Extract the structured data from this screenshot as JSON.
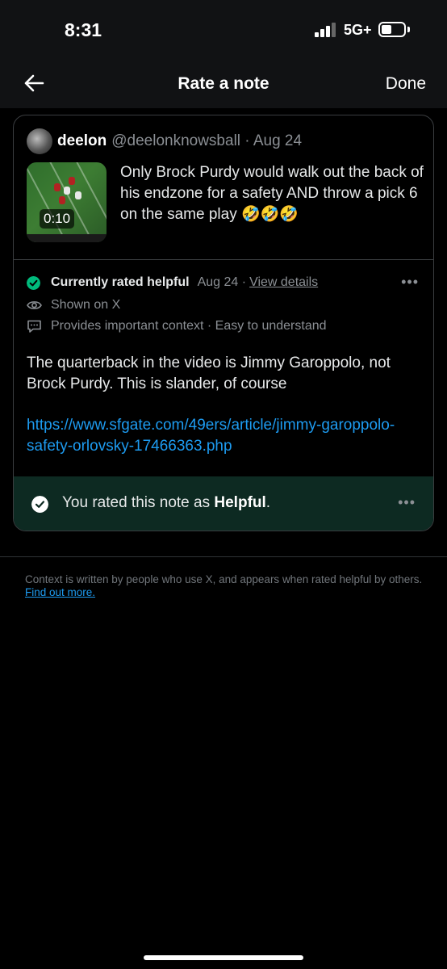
{
  "status_bar": {
    "time": "8:31",
    "network": "5G+"
  },
  "nav": {
    "title": "Rate a note",
    "done_label": "Done"
  },
  "tweet": {
    "author": "deelon",
    "handle_date": "@deelonknowsball · Aug 24",
    "video_duration": "0:10",
    "text": "Only Brock Purdy would walk out the back of his endzone for a safety AND throw a pick 6 on the same play 🤣🤣🤣"
  },
  "note": {
    "status_title": "Currently rated helpful",
    "date": "Aug 24 ·",
    "view_details": "View details",
    "shown_on": "Shown on X",
    "context": "Provides important context · Easy to understand",
    "text": "The quarterback in the video is Jimmy Garoppolo, not Brock Purdy. This is slander, of course",
    "url": "https://www.sfgate.com/49ers/article/jimmy-garoppolo-safety-orlovsky-17466363.php"
  },
  "rating": {
    "prefix": "You rated this note as ",
    "value": "Helpful",
    "suffix": "."
  },
  "footer": {
    "text": "Context is written by people who use X, and appears when rated helpful by others. ",
    "link": "Find out more."
  },
  "icons": [
    "back-arrow-icon",
    "check-circle-icon",
    "eye-icon",
    "comment-icon",
    "more-icon"
  ],
  "colors": {
    "helpful_green": "#00ba7c",
    "link_blue": "#1d9bf0",
    "rated_bar_bg": "#0d2a22"
  }
}
